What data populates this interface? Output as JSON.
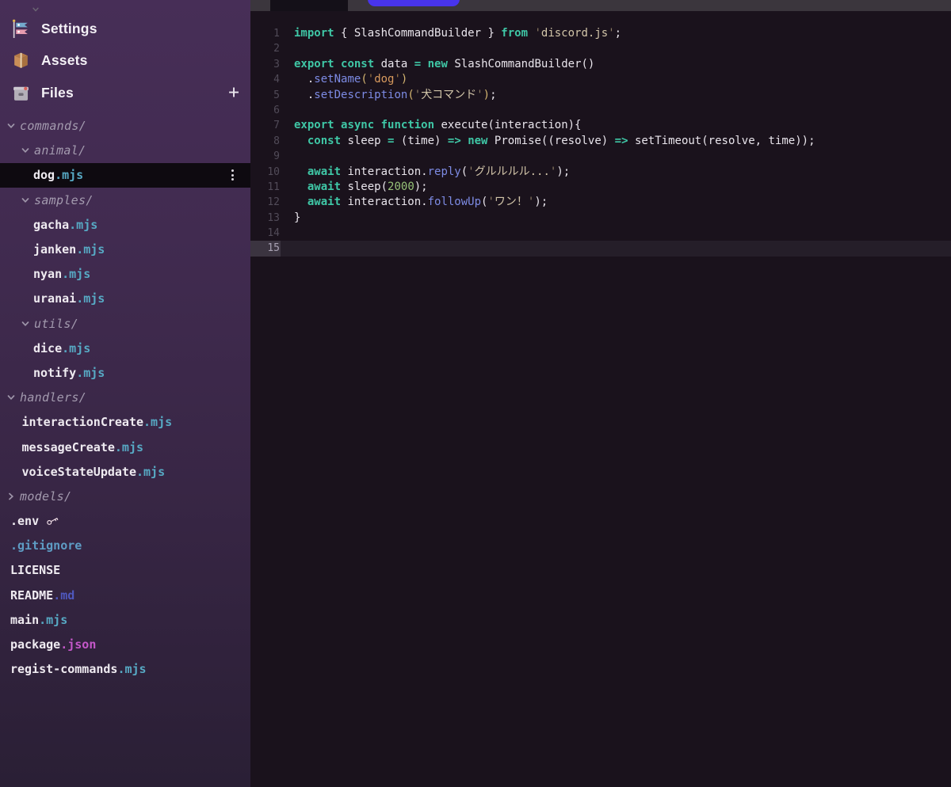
{
  "sidebar": {
    "nav": [
      {
        "icon": "carp-streamer-icon",
        "label": "Settings"
      },
      {
        "icon": "package-icon",
        "label": "Assets"
      },
      {
        "icon": "file-box-icon",
        "label": "Files",
        "action_label": "+"
      }
    ],
    "tree": [
      {
        "kind": "folder",
        "depth": 1,
        "label": "commands/",
        "state": "expanded"
      },
      {
        "kind": "folder",
        "depth": 2,
        "label": "animal/",
        "state": "expanded"
      },
      {
        "kind": "file",
        "depth": 3,
        "base": "dog",
        "ext": ".mjs",
        "ext_color": "mjs",
        "selected": true,
        "menu_icon": "kebab-menu-icon"
      },
      {
        "kind": "folder",
        "depth": 2,
        "label": "samples/",
        "state": "expanded"
      },
      {
        "kind": "file",
        "depth": 3,
        "base": "gacha",
        "ext": ".mjs",
        "ext_color": "mjs"
      },
      {
        "kind": "file",
        "depth": 3,
        "base": "janken",
        "ext": ".mjs",
        "ext_color": "mjs"
      },
      {
        "kind": "file",
        "depth": 3,
        "base": "nyan",
        "ext": ".mjs",
        "ext_color": "mjs"
      },
      {
        "kind": "file",
        "depth": 3,
        "base": "uranai",
        "ext": ".mjs",
        "ext_color": "mjs"
      },
      {
        "kind": "folder",
        "depth": 2,
        "label": "utils/",
        "state": "expanded"
      },
      {
        "kind": "file",
        "depth": 3,
        "base": "dice",
        "ext": ".mjs",
        "ext_color": "mjs"
      },
      {
        "kind": "file",
        "depth": 3,
        "base": "notify",
        "ext": ".mjs",
        "ext_color": "mjs"
      },
      {
        "kind": "folder",
        "depth": 1,
        "label": "handlers/",
        "state": "expanded"
      },
      {
        "kind": "file",
        "depth": 2,
        "base": "interactionCreate",
        "ext": ".mjs",
        "ext_color": "mjs"
      },
      {
        "kind": "file",
        "depth": 2,
        "base": "messageCreate",
        "ext": ".mjs",
        "ext_color": "mjs"
      },
      {
        "kind": "file",
        "depth": 2,
        "base": "voiceStateUpdate",
        "ext": ".mjs",
        "ext_color": "mjs"
      },
      {
        "kind": "folder",
        "depth": 1,
        "label": "models/",
        "state": "collapsed"
      },
      {
        "kind": "file",
        "depth": 1,
        "base": ".env",
        "ext": "",
        "ext_color": "",
        "trailing_icon": "key-icon"
      },
      {
        "kind": "file",
        "depth": 1,
        "base": "",
        "ext": ".gitignore",
        "ext_color": "gitignore"
      },
      {
        "kind": "file",
        "depth": 1,
        "base": "LICENSE",
        "ext": "",
        "ext_color": ""
      },
      {
        "kind": "file",
        "depth": 1,
        "base": "README",
        "ext": ".md",
        "ext_color": "md"
      },
      {
        "kind": "file",
        "depth": 1,
        "base": "main",
        "ext": ".mjs",
        "ext_color": "mjs"
      },
      {
        "kind": "file",
        "depth": 1,
        "base": "package",
        "ext": ".json",
        "ext_color": "json"
      },
      {
        "kind": "file",
        "depth": 1,
        "base": "regist-commands",
        "ext": ".mjs",
        "ext_color": "mjs"
      }
    ]
  },
  "editor": {
    "tab": {
      "label": ""
    },
    "primary_button": {
      "label": ""
    },
    "code": {
      "language": "javascript",
      "lines": [
        {
          "n": 1,
          "seg": [
            [
              "kw",
              "import"
            ],
            [
              "txt",
              " { SlashCommandBuilder } "
            ],
            [
              "kw",
              "from"
            ],
            [
              "txt",
              " "
            ],
            [
              "strq",
              "'"
            ],
            [
              "str",
              "discord.js"
            ],
            [
              "strq",
              "'"
            ],
            [
              "txt",
              ";"
            ]
          ]
        },
        {
          "n": 2,
          "seg": []
        },
        {
          "n": 3,
          "seg": [
            [
              "kw",
              "export"
            ],
            [
              "txt",
              " "
            ],
            [
              "kw",
              "const"
            ],
            [
              "txt",
              " data "
            ],
            [
              "kw",
              "="
            ],
            [
              "txt",
              " "
            ],
            [
              "kw",
              "new"
            ],
            [
              "txt",
              " SlashCommandBuilder()"
            ]
          ]
        },
        {
          "n": 4,
          "seg": [
            [
              "txt",
              "  ."
            ],
            [
              "fn",
              "setName"
            ],
            [
              "gold",
              "("
            ],
            [
              "orangeq",
              "'"
            ],
            [
              "orange",
              "dog"
            ],
            [
              "orangeq",
              "'"
            ],
            [
              "gold",
              ")"
            ]
          ]
        },
        {
          "n": 5,
          "seg": [
            [
              "txt",
              "  ."
            ],
            [
              "fn",
              "setDescription"
            ],
            [
              "gold",
              "("
            ],
            [
              "strq",
              "'"
            ],
            [
              "str",
              "犬コマンド"
            ],
            [
              "strq",
              "'"
            ],
            [
              "gold",
              ")"
            ],
            [
              "txt",
              ";"
            ]
          ]
        },
        {
          "n": 6,
          "seg": []
        },
        {
          "n": 7,
          "fold": true,
          "seg": [
            [
              "kw",
              "export"
            ],
            [
              "txt",
              " "
            ],
            [
              "kw",
              "async"
            ],
            [
              "txt",
              " "
            ],
            [
              "kw",
              "function"
            ],
            [
              "txt",
              " execute(interaction){"
            ]
          ]
        },
        {
          "n": 8,
          "seg": [
            [
              "txt",
              "  "
            ],
            [
              "kw",
              "const"
            ],
            [
              "txt",
              " sleep "
            ],
            [
              "kw",
              "="
            ],
            [
              "txt",
              " (time) "
            ],
            [
              "kw",
              "=>"
            ],
            [
              "txt",
              " "
            ],
            [
              "kw",
              "new"
            ],
            [
              "txt",
              " Promise((resolve) "
            ],
            [
              "kw",
              "=>"
            ],
            [
              "txt",
              " setTimeout(resolve, time));"
            ]
          ]
        },
        {
          "n": 9,
          "seg": []
        },
        {
          "n": 10,
          "seg": [
            [
              "txt",
              "  "
            ],
            [
              "kw",
              "await"
            ],
            [
              "txt",
              " interaction."
            ],
            [
              "fn",
              "reply"
            ],
            [
              "txt",
              "("
            ],
            [
              "strq",
              "'"
            ],
            [
              "str",
              "グルルルル..."
            ],
            [
              "strq",
              "'"
            ],
            [
              "txt",
              ");"
            ]
          ]
        },
        {
          "n": 11,
          "seg": [
            [
              "txt",
              "  "
            ],
            [
              "kw",
              "await"
            ],
            [
              "txt",
              " sleep("
            ],
            [
              "num",
              "2000"
            ],
            [
              "txt",
              ");"
            ]
          ]
        },
        {
          "n": 12,
          "seg": [
            [
              "txt",
              "  "
            ],
            [
              "kw",
              "await"
            ],
            [
              "txt",
              " interaction."
            ],
            [
              "fn",
              "followUp"
            ],
            [
              "txt",
              "("
            ],
            [
              "strq",
              "'"
            ],
            [
              "str",
              "ワン！"
            ],
            [
              "strq",
              "'"
            ],
            [
              "txt",
              ");"
            ]
          ]
        },
        {
          "n": 13,
          "seg": [
            [
              "txt",
              "}"
            ]
          ]
        },
        {
          "n": 14,
          "seg": []
        },
        {
          "n": 15,
          "seg": [],
          "current": true
        }
      ]
    }
  },
  "colors": {
    "kw": "#3fc7a6",
    "txt": "#e9e5ec",
    "fn": "#7d8be4",
    "str": "#d2c5a9",
    "strq": "#8d7c64",
    "orange": "#d89a5e",
    "orangeq": "#9c7544",
    "num": "#97c379",
    "gold": "#d3b470",
    "accent_button": "#4834ec",
    "ext_mjs": "#57a9c4",
    "ext_md": "#4f58bd",
    "ext_json": "#c457c9",
    "ext_gitignore": "#5e9cc4"
  }
}
